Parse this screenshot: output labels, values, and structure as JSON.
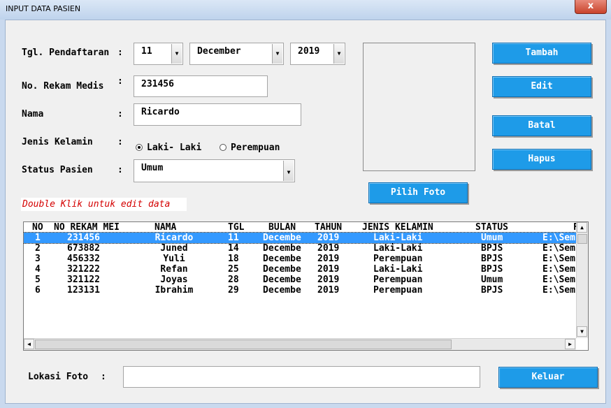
{
  "window": {
    "title": "INPUT DATA PASIEN",
    "close_glyph": "x"
  },
  "form": {
    "tgl_label": "Tgl. Pendaftaran",
    "rm_label": "No. Rekam Medis",
    "nama_label": "Nama",
    "jk_label": "Jenis Kelamin",
    "status_label": "Status Pasien",
    "colon": ":",
    "day": "11",
    "month": "December",
    "year": "2019",
    "rm_value": "231456",
    "nama_value": "Ricardo",
    "jk_options": [
      {
        "label": "Laki- Laki",
        "checked": true
      },
      {
        "label": "Perempuan",
        "checked": false
      }
    ],
    "status_value": "Umum",
    "hint": "Double Klik untuk edit data",
    "lokasi_label": "Lokasi Foto",
    "lokasi_value": ""
  },
  "buttons": {
    "tambah": "Tambah",
    "edit": "Edit",
    "batal": "Batal",
    "hapus": "Hapus",
    "pilih_foto": "Pilih Foto",
    "keluar": "Keluar"
  },
  "table": {
    "columns": [
      "NO",
      "NO REKAM MEI",
      "NAMA",
      "TGL",
      "BULAN",
      "TAHUN",
      "JENIS KELAMIN",
      "STATUS",
      "F"
    ],
    "rows": [
      [
        "1",
        "231456",
        "Ricardo",
        "11",
        "Decembe",
        "2019",
        "Laki-Laki",
        "Umum",
        "E:\\Sem"
      ],
      [
        "2",
        "673882",
        "Juned",
        "14",
        "Decembe",
        "2019",
        "Laki-Laki",
        "BPJS",
        "E:\\Sem"
      ],
      [
        "3",
        "456332",
        "Yuli",
        "18",
        "Decembe",
        "2019",
        "Perempuan",
        "BPJS",
        "E:\\Sem"
      ],
      [
        "4",
        "321222",
        "Refan",
        "25",
        "Decembe",
        "2019",
        "Laki-Laki",
        "BPJS",
        "E:\\Sem"
      ],
      [
        "5",
        "321122",
        "Joyas",
        "28",
        "Decembe",
        "2019",
        "Perempuan",
        "Umum",
        "E:\\Sem"
      ],
      [
        "6",
        "123131",
        "Ibrahim",
        "29",
        "Decembe",
        "2019",
        "Perempuan",
        "BPJS",
        "E:\\Sem"
      ]
    ],
    "selected_row": 0
  },
  "icons": {
    "dropdown": "chevron-down-icon",
    "scroll_up": "scroll-up-icon",
    "scroll_down": "scroll-down-icon",
    "scroll_left": "scroll-left-icon",
    "scroll_right": "scroll-right-icon"
  },
  "colors": {
    "button_bg": "#1e9be8",
    "selection": "#3399ff",
    "hint_text": "#d40000",
    "close_button": "#c9432b"
  }
}
